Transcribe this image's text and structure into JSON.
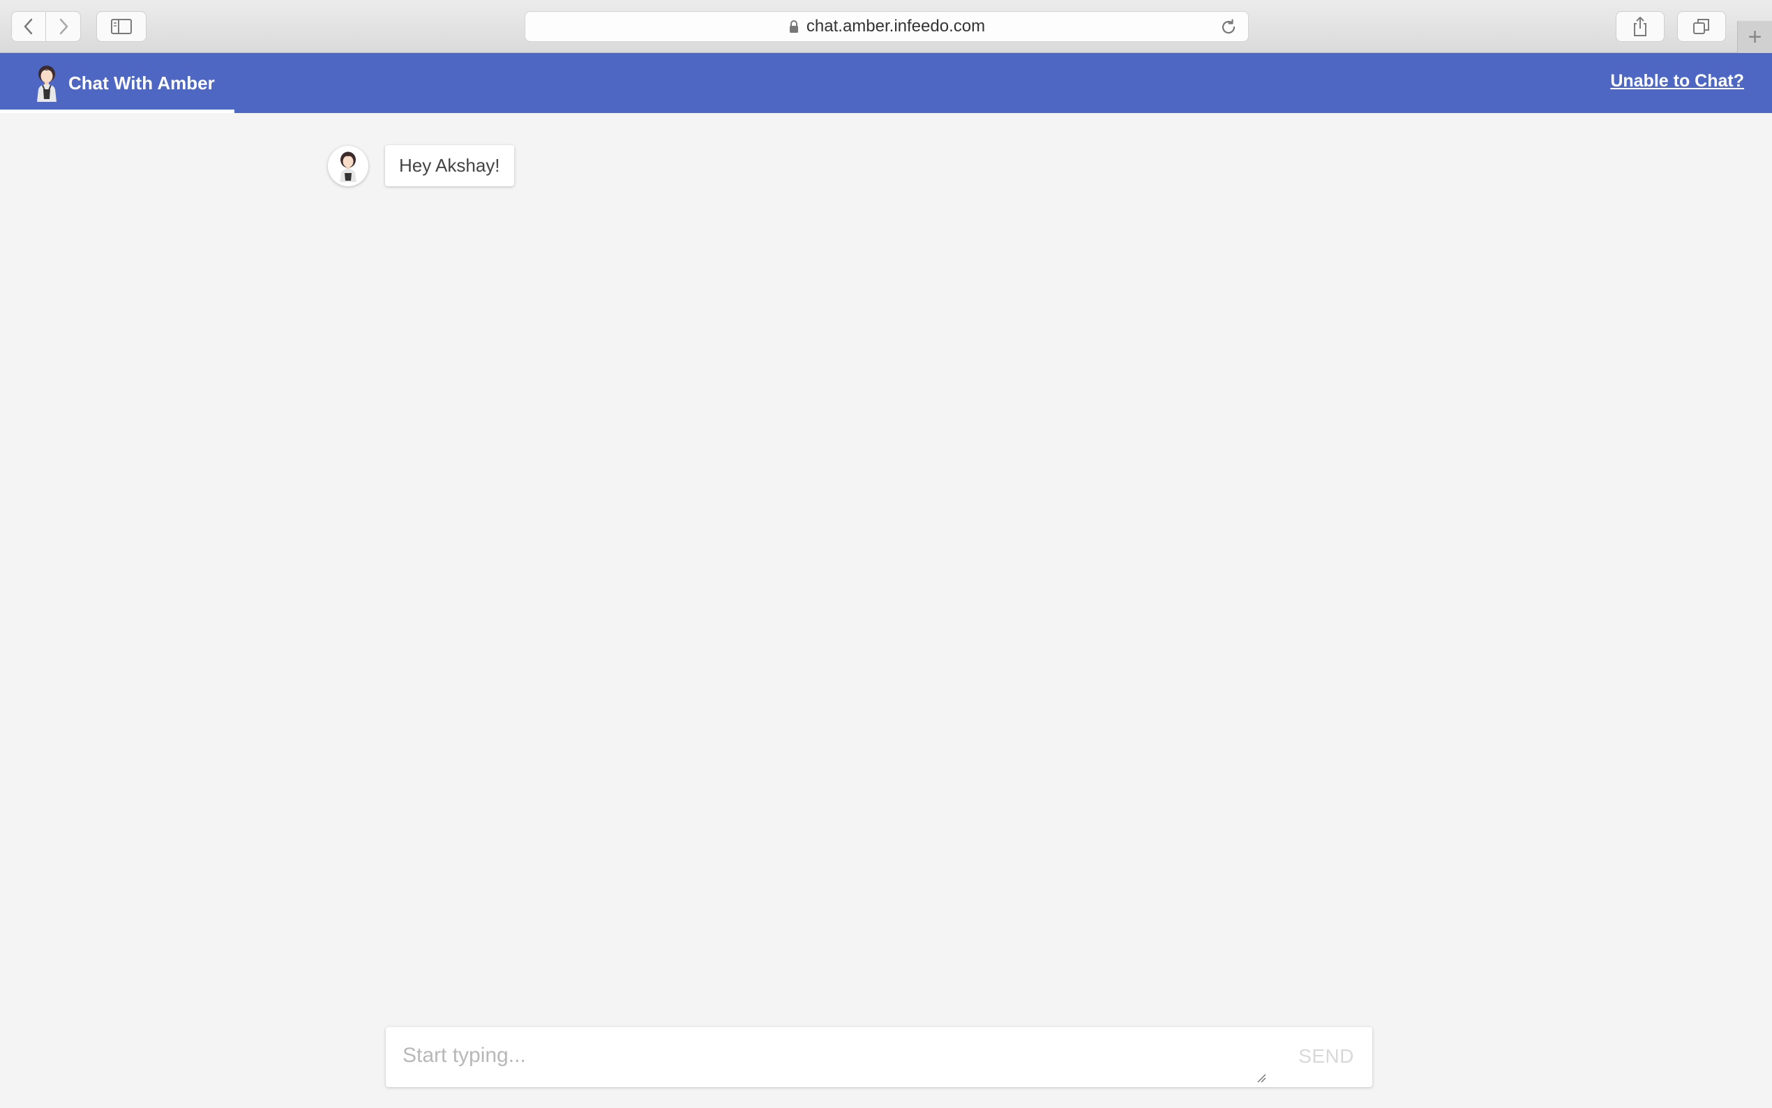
{
  "browser": {
    "url": "chat.amber.infeedo.com",
    "icons": {
      "back": "chevron-left-icon",
      "forward": "chevron-right-icon",
      "sidebar": "sidebar-icon",
      "lock": "lock-icon",
      "reload": "reload-icon",
      "share": "share-icon",
      "tabs": "tabs-icon",
      "new_tab": "plus-icon"
    },
    "new_tab_glyph": "+"
  },
  "header": {
    "title": "Chat With Amber",
    "help_link": "Unable to Chat?",
    "background_color": "#4e67c3"
  },
  "messages": [
    {
      "sender": "bot",
      "text": "Hey Akshay!"
    }
  ],
  "composer": {
    "placeholder": "Start typing...",
    "send_label": "SEND"
  }
}
